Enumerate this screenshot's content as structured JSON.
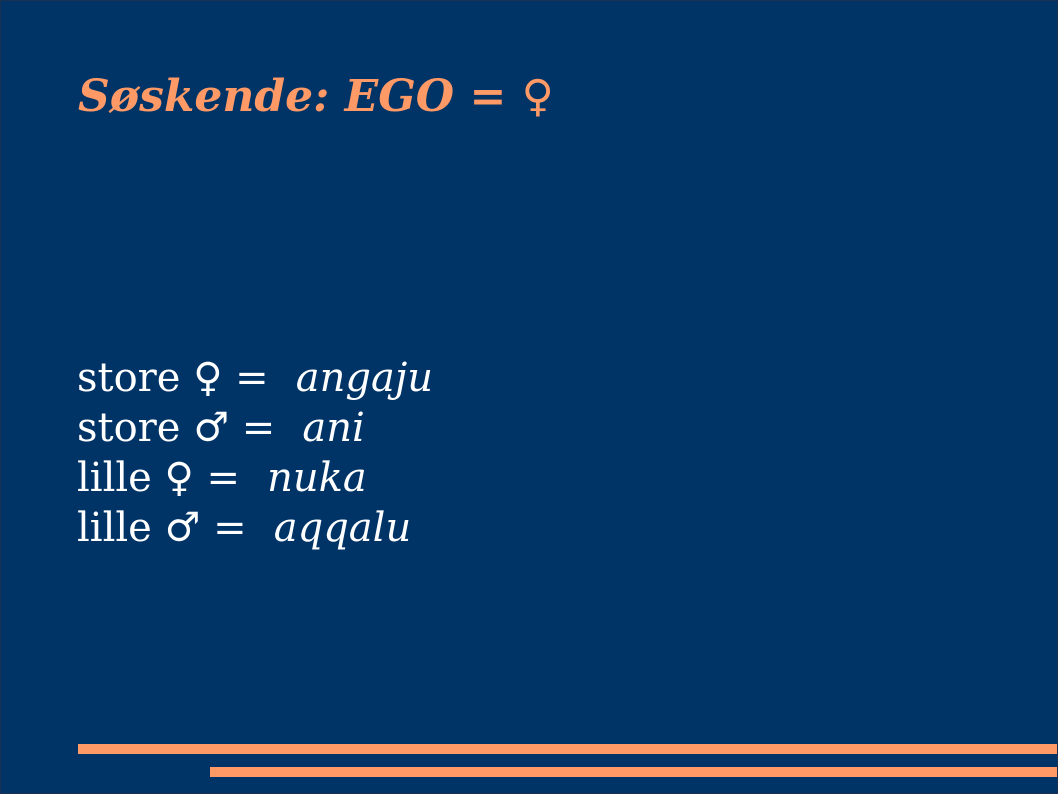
{
  "slide": {
    "title": "Søskende: EGO = ♀",
    "lines": [
      {
        "prefix": "store ♀ =",
        "term": "angaju"
      },
      {
        "prefix": "store ♂ =",
        "term": "ani"
      },
      {
        "prefix": "lille ♀ =",
        "term": "nuka"
      },
      {
        "prefix": "lille ♂ =",
        "term": "aqqalu"
      }
    ]
  },
  "colors": {
    "background": "#003366",
    "accent": "#ff9966",
    "text": "#ffffff"
  }
}
